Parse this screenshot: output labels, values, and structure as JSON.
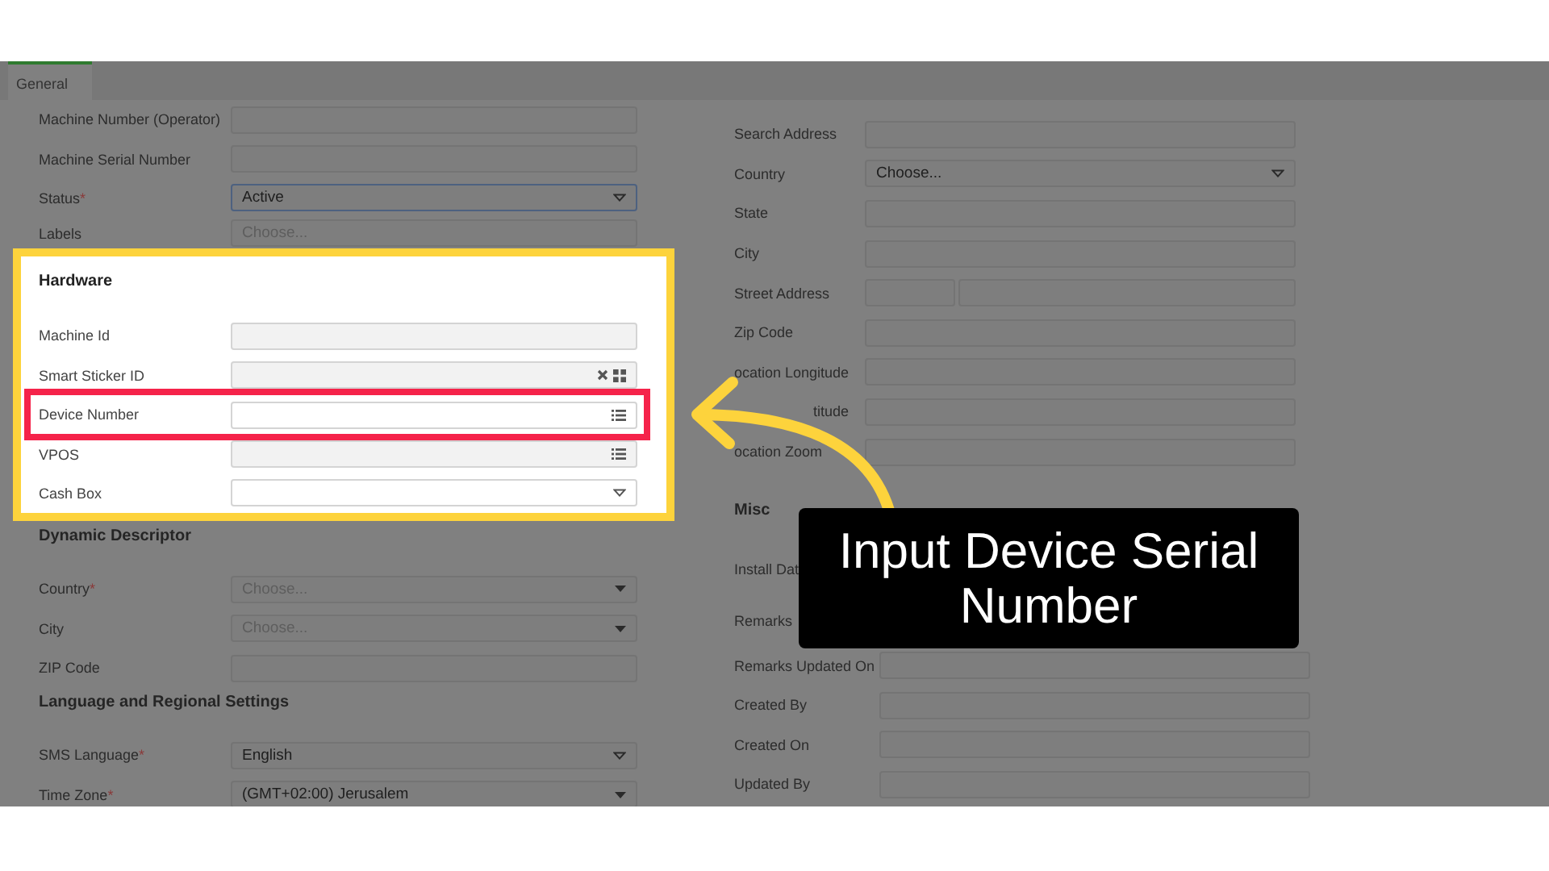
{
  "tabs": [
    {
      "label": "General",
      "selected": true
    }
  ],
  "left_sections": [
    {
      "rows": [
        {
          "label": "Machine Number (Operator)",
          "kind": "text"
        },
        {
          "label": "Machine Serial Number",
          "kind": "text"
        },
        {
          "label": "Status",
          "mark": "*",
          "kind": "select",
          "value": "Active",
          "focused": true,
          "caret": {
            "kind": "outline"
          }
        },
        {
          "label": "Labels",
          "kind": "select",
          "placeholder": "Choose..."
        }
      ]
    },
    {
      "title": "Hardware",
      "highlighted": true,
      "rows": [
        {
          "label": "Machine Id",
          "kind": "text",
          "disabled": true
        },
        {
          "label": "Smart Sticker ID",
          "kind": "text",
          "disabled": true,
          "icons": [
            {
              "kind": "clear"
            },
            {
              "kind": "grid"
            }
          ]
        },
        {
          "label": "Device Number",
          "kind": "text",
          "disabled": false,
          "highlighted": true,
          "icons": [
            {
              "kind": "list"
            }
          ]
        },
        {
          "label": "VPOS",
          "kind": "text",
          "disabled": true,
          "icons": [
            {
              "kind": "list"
            }
          ]
        },
        {
          "label": "Cash Box",
          "kind": "select",
          "caret": {
            "kind": "outline"
          }
        }
      ]
    },
    {
      "title": "Dynamic Descriptor",
      "rows": [
        {
          "label": "Country",
          "mark": "*",
          "kind": "select",
          "placeholder": "Choose...",
          "caret": {
            "kind": "filled"
          }
        },
        {
          "label": "City",
          "kind": "select",
          "placeholder": "Choose...",
          "caret": {
            "kind": "filled"
          }
        },
        {
          "label": "ZIP Code",
          "kind": "text"
        }
      ]
    },
    {
      "title": "Language and Regional Settings",
      "rows": [
        {
          "label": "SMS Language",
          "mark": "*",
          "kind": "select",
          "value": "English",
          "caret": {
            "kind": "outline"
          }
        },
        {
          "label": "Time Zone",
          "mark": "*",
          "kind": "select",
          "value": "(GMT+02:00) Jerusalem",
          "caret": {
            "kind": "filled"
          }
        }
      ]
    }
  ],
  "right_sections": [
    {
      "rows": [
        {
          "label": "Search Address",
          "kind": "text"
        },
        {
          "label": "Country",
          "kind": "select",
          "value": "Choose...",
          "caret": {
            "kind": "outline"
          }
        },
        {
          "label": "State",
          "kind": "text"
        },
        {
          "label": "City",
          "kind": "text"
        },
        {
          "label": "Street Address",
          "kind": "split"
        },
        {
          "label": "Zip Code",
          "kind": "text"
        },
        {
          "label": "ocation Longitude",
          "kind": "text"
        },
        {
          "label": "titude",
          "kind": "text"
        },
        {
          "label": "ocation Zoom",
          "kind": "text"
        }
      ]
    },
    {
      "title": "Misc",
      "rows": [
        {
          "label": "Install Dat",
          "kind": "hidden"
        },
        {
          "label": "Remarks",
          "kind": "hidden"
        },
        {
          "label": "Remarks Updated On",
          "kind": "text"
        },
        {
          "label": "Created By",
          "kind": "text"
        },
        {
          "label": "Created On",
          "kind": "text"
        },
        {
          "label": "Updated By",
          "kind": "text"
        }
      ]
    }
  ],
  "callout": {
    "text": "Input Device Serial Number"
  }
}
